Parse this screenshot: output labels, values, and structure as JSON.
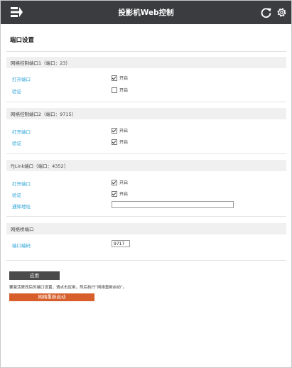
{
  "header": {
    "title": "投影机Web控制",
    "menu_icon": "menu-icon",
    "refresh_icon": "refresh-icon",
    "settings_icon": "gear-icon"
  },
  "page": {
    "title": "端口设置"
  },
  "sections": [
    {
      "header": "网络控制端口1（端口：23）",
      "rows": [
        {
          "label": "打开端口",
          "checkbox_label": "开启",
          "checked": true
        },
        {
          "label": "验证",
          "checkbox_label": "开启",
          "checked": false
        }
      ]
    },
    {
      "header": "网络控制端口2（端口：9715）",
      "rows": [
        {
          "label": "打开端口",
          "checkbox_label": "开启",
          "checked": true
        },
        {
          "label": "验证",
          "checkbox_label": "开启",
          "checked": true
        }
      ]
    },
    {
      "header": "PJLink端口（端口：4352）",
      "rows": [
        {
          "label": "打开端口",
          "checkbox_label": "开启",
          "checked": true
        },
        {
          "label": "验证",
          "checkbox_label": "开启",
          "checked": true
        },
        {
          "label": "通知地址",
          "input_value": ""
        }
      ]
    },
    {
      "header": "网络桥端口",
      "rows": [
        {
          "label": "端口编码",
          "input_value": "9717"
        }
      ]
    }
  ],
  "footer": {
    "apply_label": "应用",
    "hint": "要激活更改后的端口设置，请点击应用，然后执行“网络重新启动”。",
    "restart_label": "网络重新启动"
  },
  "colors": {
    "header_bg": "#3a3c3f",
    "label_blue": "#2aa3d6",
    "restart_orange": "#d65f2c",
    "apply_gray": "#4a4a4a"
  }
}
